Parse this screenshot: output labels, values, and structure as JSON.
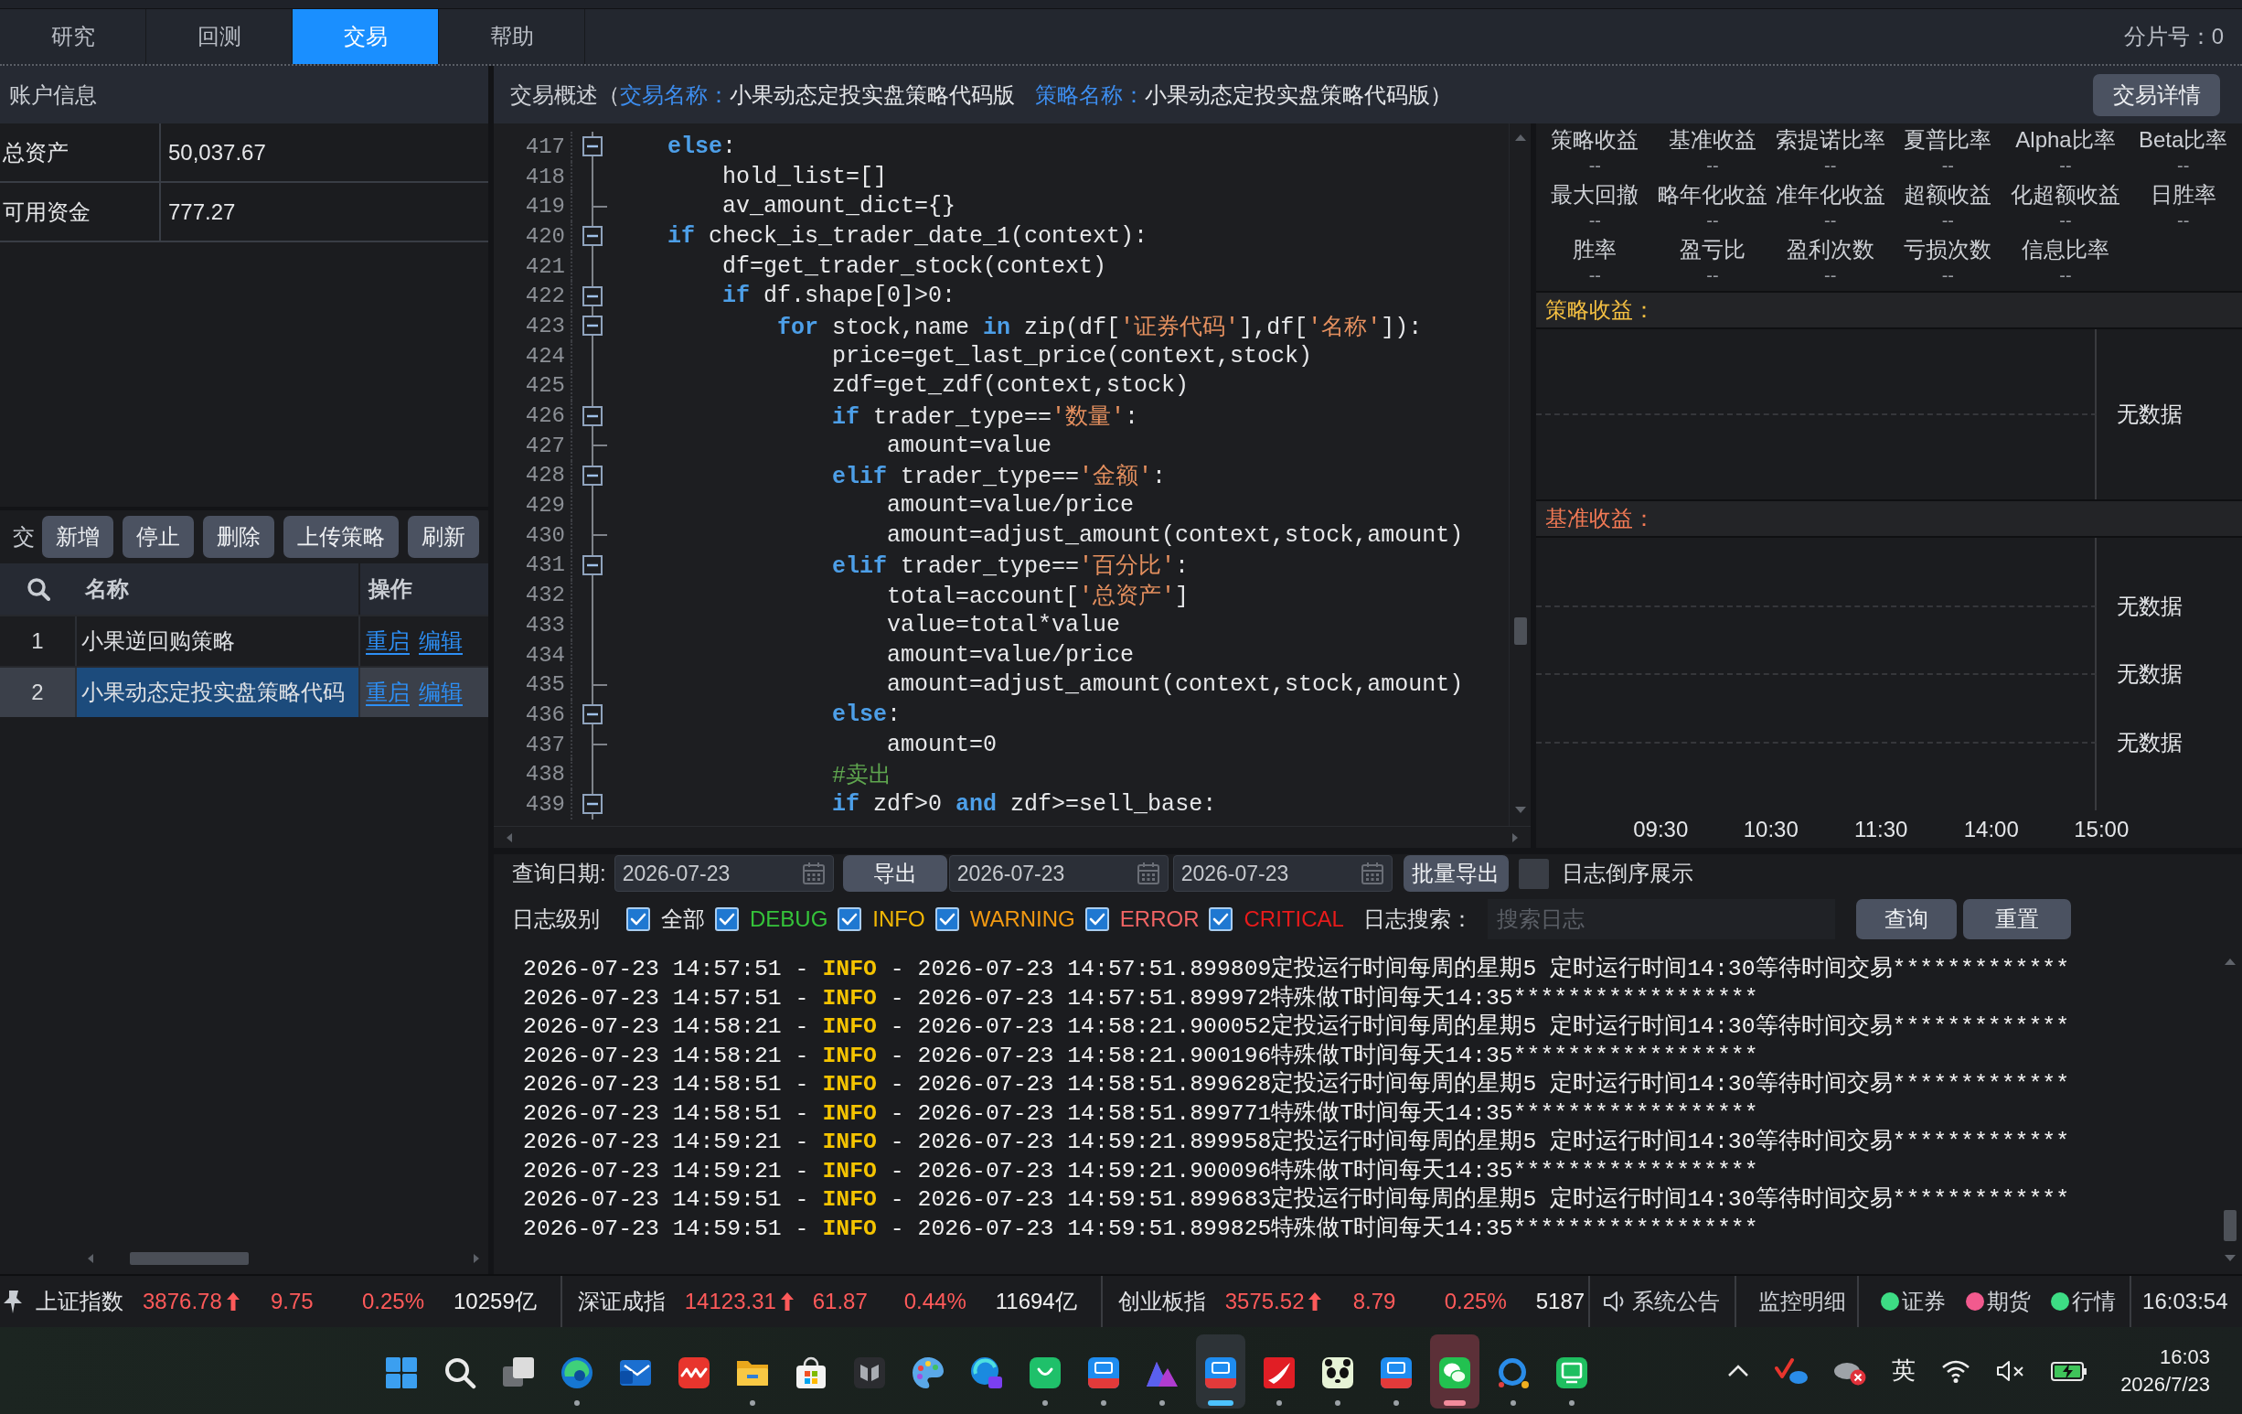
{
  "tabs": [
    {
      "label": "研究",
      "selected": false
    },
    {
      "label": "回测",
      "selected": false
    },
    {
      "label": "交易",
      "selected": true
    },
    {
      "label": "帮助",
      "selected": false
    }
  ],
  "shard_label": "分片号：0",
  "account": {
    "title": "账户信息",
    "rows": [
      {
        "label": "总资产",
        "value": "50,037.67"
      },
      {
        "label": "可用资金",
        "value": "777.27"
      }
    ]
  },
  "strategies": {
    "label": "交",
    "buttons": [
      "新增",
      "停止",
      "删除",
      "上传策略",
      "刷新"
    ],
    "columns": [
      "名称",
      "操作"
    ],
    "rows": [
      {
        "index": "1",
        "name": "小果逆回购策略",
        "actions": [
          "重启",
          "编辑"
        ],
        "selected": false
      },
      {
        "index": "2",
        "name": "小果动态定投实盘策略代码",
        "actions": [
          "重启",
          "编辑"
        ],
        "selected": true
      }
    ]
  },
  "overview": {
    "title": "交易概述（",
    "fields": [
      {
        "label": "交易名称：",
        "value": "小果动态定投实盘策略代码版"
      },
      {
        "label": "策略名称：",
        "value": "小果动态定投实盘策略代码版）"
      }
    ],
    "button": "交易详情"
  },
  "editor": {
    "lines": [
      {
        "number": "417",
        "foldable": true,
        "tokens": [
          {
            "kind": "keyword",
            "text": "else"
          },
          {
            "kind": "plain",
            "text": ":"
          }
        ],
        "children": [
          {
            "number": "418",
            "foldable": false,
            "tokens": [
              {
                "kind": "plain",
                "text": "hold_list=[]"
              }
            ]
          },
          {
            "number": "419",
            "foldable": false,
            "tokens": [
              {
                "kind": "plain",
                "text": "av_amount_dict={}"
              }
            ]
          }
        ]
      },
      {
        "number": "420",
        "foldable": true,
        "tokens": [
          {
            "kind": "keyword",
            "text": "if"
          },
          {
            "kind": "plain",
            "text": " check_is_trader_date_1(context):"
          }
        ],
        "children": [
          {
            "number": "421",
            "foldable": false,
            "tokens": [
              {
                "kind": "plain",
                "text": "df=get_trader_stock(context)"
              }
            ]
          },
          {
            "number": "422",
            "foldable": true,
            "tokens": [
              {
                "kind": "keyword",
                "text": "if"
              },
              {
                "kind": "plain",
                "text": " df.shape[0]>0:"
              }
            ],
            "children": [
              {
                "number": "423",
                "foldable": true,
                "tokens": [
                  {
                    "kind": "keyword",
                    "text": "for"
                  },
                  {
                    "kind": "plain",
                    "text": " stock,name "
                  },
                  {
                    "kind": "keyword",
                    "text": "in"
                  },
                  {
                    "kind": "plain",
                    "text": " zip(df["
                  },
                  {
                    "kind": "string",
                    "text": "'证券代码'"
                  },
                  {
                    "kind": "plain",
                    "text": "],df["
                  },
                  {
                    "kind": "string",
                    "text": "'名称'"
                  },
                  {
                    "kind": "plain",
                    "text": "]):"
                  }
                ],
                "children": [
                  {
                    "number": "424",
                    "foldable": false,
                    "tokens": [
                      {
                        "kind": "plain",
                        "text": "price=get_last_price(context,stock)"
                      }
                    ]
                  },
                  {
                    "number": "425",
                    "foldable": false,
                    "tokens": [
                      {
                        "kind": "plain",
                        "text": "zdf=get_zdf(context,stock)"
                      }
                    ]
                  },
                  {
                    "number": "426",
                    "foldable": true,
                    "tokens": [
                      {
                        "kind": "keyword",
                        "text": "if"
                      },
                      {
                        "kind": "plain",
                        "text": " trader_type=="
                      },
                      {
                        "kind": "string",
                        "text": "'数量'"
                      },
                      {
                        "kind": "plain",
                        "text": ":"
                      }
                    ],
                    "children": [
                      {
                        "number": "427",
                        "foldable": false,
                        "tokens": [
                          {
                            "kind": "plain",
                            "text": "amount=value"
                          }
                        ]
                      }
                    ]
                  },
                  {
                    "number": "428",
                    "foldable": true,
                    "tokens": [
                      {
                        "kind": "keyword",
                        "text": "elif"
                      },
                      {
                        "kind": "plain",
                        "text": " trader_type=="
                      },
                      {
                        "kind": "string",
                        "text": "'金额'"
                      },
                      {
                        "kind": "plain",
                        "text": ":"
                      }
                    ],
                    "children": [
                      {
                        "number": "429",
                        "foldable": false,
                        "tokens": [
                          {
                            "kind": "plain",
                            "text": "amount=value/price"
                          }
                        ]
                      },
                      {
                        "number": "430",
                        "foldable": false,
                        "tokens": [
                          {
                            "kind": "plain",
                            "text": "amount=adjust_amount(context,stock,amount)"
                          }
                        ]
                      }
                    ]
                  },
                  {
                    "number": "431",
                    "foldable": true,
                    "tokens": [
                      {
                        "kind": "keyword",
                        "text": "elif"
                      },
                      {
                        "kind": "plain",
                        "text": " trader_type=="
                      },
                      {
                        "kind": "string",
                        "text": "'百分比'"
                      },
                      {
                        "kind": "plain",
                        "text": ":"
                      }
                    ],
                    "children": [
                      {
                        "number": "432",
                        "foldable": false,
                        "tokens": [
                          {
                            "kind": "plain",
                            "text": "total=account["
                          },
                          {
                            "kind": "string",
                            "text": "'总资产'"
                          },
                          {
                            "kind": "plain",
                            "text": "]"
                          }
                        ]
                      },
                      {
                        "number": "433",
                        "foldable": false,
                        "tokens": [
                          {
                            "kind": "plain",
                            "text": "value=total*value"
                          }
                        ]
                      },
                      {
                        "number": "434",
                        "foldable": false,
                        "tokens": [
                          {
                            "kind": "plain",
                            "text": "amount=value/price"
                          }
                        ]
                      },
                      {
                        "number": "435",
                        "foldable": false,
                        "tokens": [
                          {
                            "kind": "plain",
                            "text": "amount=adjust_amount(context,stock,amount)"
                          }
                        ]
                      }
                    ]
                  },
                  {
                    "number": "436",
                    "foldable": true,
                    "tokens": [
                      {
                        "kind": "keyword",
                        "text": "else"
                      },
                      {
                        "kind": "plain",
                        "text": ":"
                      }
                    ],
                    "children": [
                      {
                        "number": "437",
                        "foldable": false,
                        "tokens": [
                          {
                            "kind": "plain",
                            "text": "amount=0"
                          }
                        ]
                      }
                    ]
                  },
                  {
                    "number": "438",
                    "foldable": false,
                    "tokens": [
                      {
                        "kind": "comment",
                        "text": "#卖出"
                      }
                    ]
                  },
                  {
                    "number": "439",
                    "foldable": true,
                    "tokens": [
                      {
                        "kind": "keyword",
                        "text": "if"
                      },
                      {
                        "kind": "plain",
                        "text": " zdf>0 "
                      },
                      {
                        "kind": "keyword",
                        "text": "and"
                      },
                      {
                        "kind": "plain",
                        "text": " zdf>=sell_base:"
                      }
                    ]
                  }
                ]
              }
            ]
          }
        ]
      }
    ]
  },
  "metrics": [
    {
      "label": "策略收益",
      "value": "--"
    },
    {
      "label": "基准收益",
      "value": "--"
    },
    {
      "label": "索提诺比率",
      "value": "--"
    },
    {
      "label": "夏普比率",
      "value": "--"
    },
    {
      "label": "Alpha比率",
      "value": "--"
    },
    {
      "label": "Beta比率",
      "value": "--"
    },
    {
      "label": "最大回撤",
      "value": "--"
    },
    {
      "label": "略年化收益",
      "value": "--"
    },
    {
      "label": "准年化收益",
      "value": "--"
    },
    {
      "label": "超额收益",
      "value": "--"
    },
    {
      "label": "化超额收益",
      "value": "--"
    },
    {
      "label": "日胜率",
      "value": "--"
    },
    {
      "label": "胜率",
      "value": "--"
    },
    {
      "label": "盈亏比",
      "value": "--"
    },
    {
      "label": "盈利次数",
      "value": "--"
    },
    {
      "label": "亏损次数",
      "value": "--"
    },
    {
      "label": "信息比率",
      "value": "--"
    }
  ],
  "charts": [
    {
      "title": "策略收益：",
      "color": "#f5c042",
      "y_labels": [
        "无数据"
      ]
    },
    {
      "title": "基准收益：",
      "color": "#f47a55",
      "y_labels": [
        "无数据",
        "无数据",
        "无数据"
      ],
      "x_labels": [
        "09:30",
        "10:30",
        "11:30",
        "14:00",
        "15:00"
      ]
    }
  ],
  "log_panel": {
    "date_label": "查询日期:",
    "date": "2026-07-23",
    "export": "导出",
    "range_start": "2026-07-23",
    "range_end": "2026-07-23",
    "batch_export": "批量导出",
    "reverse": {
      "label": "日志倒序展示",
      "checked": false
    },
    "level_label": "日志级别",
    "levels": [
      {
        "label": "全部",
        "checked": true,
        "color": "#e8e9eb"
      },
      {
        "label": "DEBUG",
        "checked": true,
        "color": "#35c43a"
      },
      {
        "label": "INFO",
        "checked": true,
        "color": "#f2b705"
      },
      {
        "label": "WARNING",
        "checked": true,
        "color": "#f39a12"
      },
      {
        "label": "ERROR",
        "checked": true,
        "color": "#f26464"
      },
      {
        "label": "CRITICAL",
        "checked": true,
        "color": "#e81b1b"
      }
    ],
    "search_label": "日志搜索：",
    "search": {
      "placeholder": "搜索日志"
    },
    "buttons": [
      "查询",
      "重置"
    ],
    "lines": [
      {
        "head": "2026-07-23 14:57:51 - ",
        "level": "INFO",
        "tail": " - 2026-07-23 14:57:51.899809定投运行时间每周的星期5 定时运行时间14:30等待时间交易*************"
      },
      {
        "head": "2026-07-23 14:57:51 - ",
        "level": "INFO",
        "tail": " - 2026-07-23 14:57:51.899972特殊做T时间每天14:35******************"
      },
      {
        "head": "2026-07-23 14:58:21 - ",
        "level": "INFO",
        "tail": " - 2026-07-23 14:58:21.900052定投运行时间每周的星期5 定时运行时间14:30等待时间交易*************"
      },
      {
        "head": "2026-07-23 14:58:21 - ",
        "level": "INFO",
        "tail": " - 2026-07-23 14:58:21.900196特殊做T时间每天14:35******************"
      },
      {
        "head": "2026-07-23 14:58:51 - ",
        "level": "INFO",
        "tail": " - 2026-07-23 14:58:51.899628定投运行时间每周的星期5 定时运行时间14:30等待时间交易*************"
      },
      {
        "head": "2026-07-23 14:58:51 - ",
        "level": "INFO",
        "tail": " - 2026-07-23 14:58:51.899771特殊做T时间每天14:35******************"
      },
      {
        "head": "2026-07-23 14:59:21 - ",
        "level": "INFO",
        "tail": " - 2026-07-23 14:59:21.899958定投运行时间每周的星期5 定时运行时间14:30等待时间交易*************"
      },
      {
        "head": "2026-07-23 14:59:21 - ",
        "level": "INFO",
        "tail": " - 2026-07-23 14:59:21.900096特殊做T时间每天14:35******************"
      },
      {
        "head": "2026-07-23 14:59:51 - ",
        "level": "INFO",
        "tail": " - 2026-07-23 14:59:51.899683定投运行时间每周的星期5 定时运行时间14:30等待时间交易*************"
      },
      {
        "head": "2026-07-23 14:59:51 - ",
        "level": "INFO",
        "tail": " - 2026-07-23 14:59:51.899825特殊做T时间每天14:35******************"
      }
    ]
  },
  "status_bar": {
    "indices": [
      {
        "name": "上证指数",
        "value": "3876.78",
        "up": true,
        "change": "9.75",
        "percent": "0.25%",
        "turnover": "10259亿"
      },
      {
        "name": "深证成指",
        "value": "14123.31",
        "up": true,
        "change": "61.87",
        "percent": "0.44%",
        "turnover": "11694亿"
      },
      {
        "name": "创业板指",
        "value": "3575.52",
        "up": true,
        "change": "8.79",
        "percent": "0.25%",
        "turnover": "5187"
      }
    ],
    "notice": "系统公告",
    "monitor": "监控明细",
    "connections": [
      {
        "label": "证券",
        "color": "#3ddc84"
      },
      {
        "label": "期货",
        "color": "#f25a8e"
      },
      {
        "label": "行情",
        "color": "#3ddc84"
      }
    ],
    "time": "16:03:54"
  },
  "taskbar": {
    "apps": [
      {
        "kind": "start",
        "running": false,
        "focused": false,
        "alert": false
      },
      {
        "kind": "search",
        "running": false,
        "focused": false,
        "alert": false
      },
      {
        "kind": "taskview",
        "running": false,
        "focused": false,
        "alert": false
      },
      {
        "kind": "swirl",
        "running": true,
        "focused": false,
        "alert": false
      },
      {
        "kind": "mail",
        "running": false,
        "focused": false,
        "alert": false
      },
      {
        "kind": "zigzag",
        "running": false,
        "focused": false,
        "alert": false
      },
      {
        "kind": "folder",
        "running": true,
        "focused": false,
        "alert": false
      },
      {
        "kind": "store",
        "running": false,
        "focused": false,
        "alert": false
      },
      {
        "kind": "dark",
        "running": false,
        "focused": false,
        "alert": false
      },
      {
        "kind": "palette",
        "running": false,
        "focused": false,
        "alert": false
      },
      {
        "kind": "swirlbadge",
        "running": false,
        "focused": false,
        "alert": false
      },
      {
        "kind": "smile",
        "running": true,
        "focused": false,
        "alert": false
      },
      {
        "kind": "tile",
        "running": true,
        "focused": false,
        "alert": false
      },
      {
        "kind": "peaks",
        "running": true,
        "focused": false,
        "alert": false
      },
      {
        "kind": "tile",
        "running": true,
        "focused": true,
        "alert": false
      },
      {
        "kind": "swoosh",
        "running": true,
        "focused": false,
        "alert": false
      },
      {
        "kind": "panda",
        "running": true,
        "focused": false,
        "alert": false
      },
      {
        "kind": "tile",
        "running": true,
        "focused": false,
        "alert": false
      },
      {
        "kind": "chat",
        "running": true,
        "focused": false,
        "alert": true
      },
      {
        "kind": "ring",
        "running": true,
        "focused": false,
        "alert": false
      },
      {
        "kind": "message",
        "running": true,
        "focused": false,
        "alert": false
      }
    ],
    "ime": "英",
    "time": "16:03",
    "date": "2026/7/23"
  }
}
